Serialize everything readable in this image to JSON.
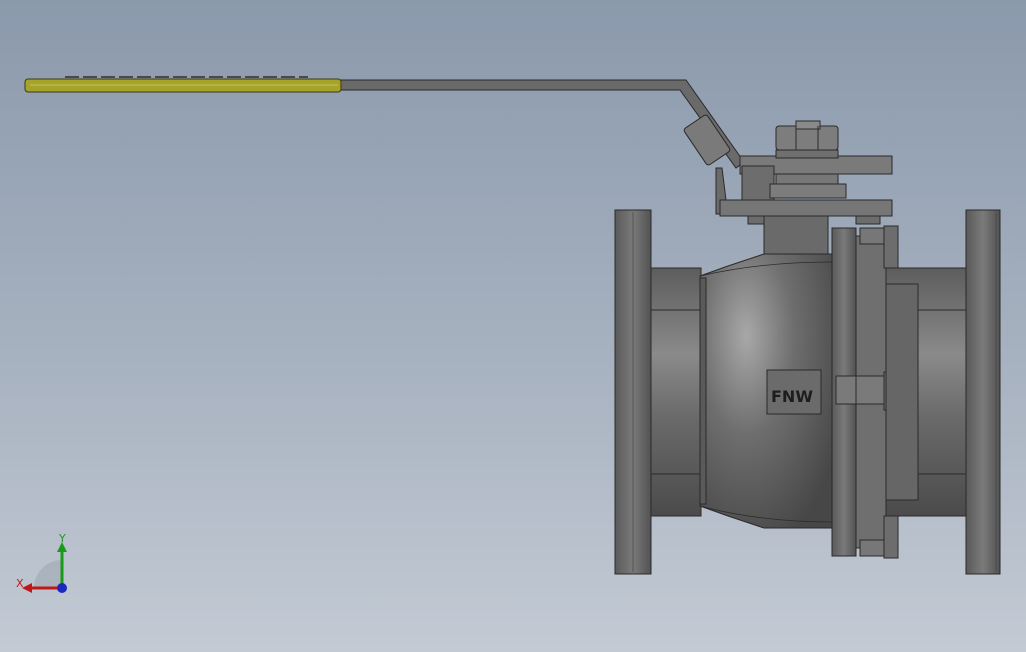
{
  "model": {
    "logo_text": "FNW",
    "handle_color": "#a6a32a",
    "body_color": "#6f6f6f"
  },
  "triad": {
    "x_label": "X",
    "y_label": "Y",
    "x_color": "#c01818",
    "y_color": "#1a9a1a",
    "z_color": "#1a2ac0"
  }
}
